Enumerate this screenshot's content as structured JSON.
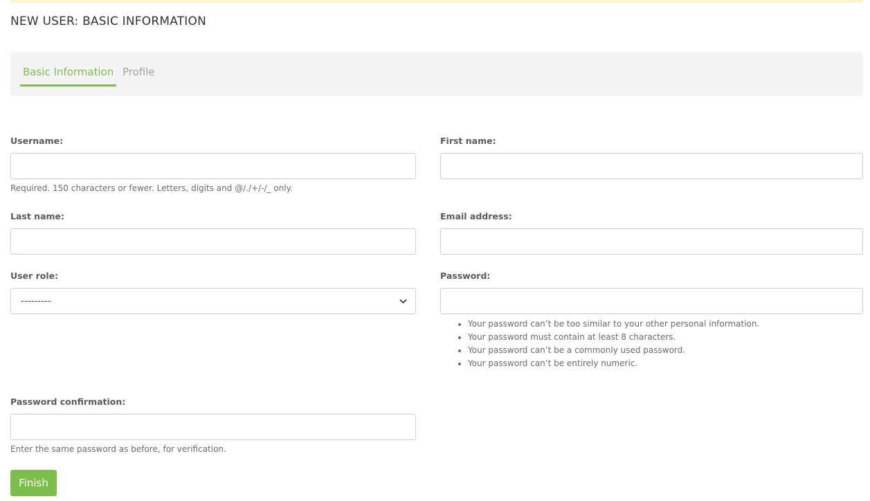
{
  "page": {
    "title": "NEW USER: BASIC INFORMATION"
  },
  "tabs": [
    {
      "label": "Basic Information",
      "active": true
    },
    {
      "label": "Profile",
      "active": false
    }
  ],
  "form": {
    "username": {
      "label": "Username:",
      "value": "",
      "help": "Required. 150 characters or fewer. Letters, digits and @/./+/-/_ only."
    },
    "first_name": {
      "label": "First name:",
      "value": ""
    },
    "last_name": {
      "label": "Last name:",
      "value": ""
    },
    "email": {
      "label": "Email address:",
      "value": ""
    },
    "user_role": {
      "label": "User role:",
      "selected": "---------"
    },
    "password": {
      "label": "Password:",
      "value": "",
      "help": [
        "Your password can’t be too similar to your other personal information.",
        "Your password must contain at least 8 characters.",
        "Your password can’t be a commonly used password.",
        "Your password can’t be entirely numeric."
      ]
    },
    "password_confirmation": {
      "label": "Password confirmation:",
      "value": "",
      "help": "Enter the same password as before, for verification."
    },
    "submit_label": "Finish"
  },
  "colors": {
    "accent": "#7cc04b",
    "tab_inactive": "#a3a3a3",
    "tabs_background": "#f4f4f4",
    "top_strip": "#fdf3cf"
  }
}
